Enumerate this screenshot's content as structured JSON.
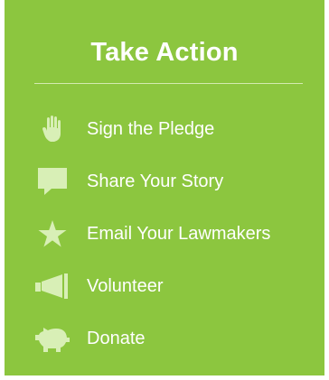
{
  "panel": {
    "title": "Take Action",
    "background": "#8cc63f",
    "icon_color": "#d8efb6"
  },
  "menu": {
    "items": [
      {
        "label": "Sign the Pledge",
        "icon": "hand-icon"
      },
      {
        "label": "Share Your Story",
        "icon": "speech-bubble-icon"
      },
      {
        "label": "Email Your Lawmakers",
        "icon": "star-icon"
      },
      {
        "label": "Volunteer",
        "icon": "megaphone-icon"
      },
      {
        "label": "Donate",
        "icon": "piggy-bank-icon"
      }
    ]
  }
}
